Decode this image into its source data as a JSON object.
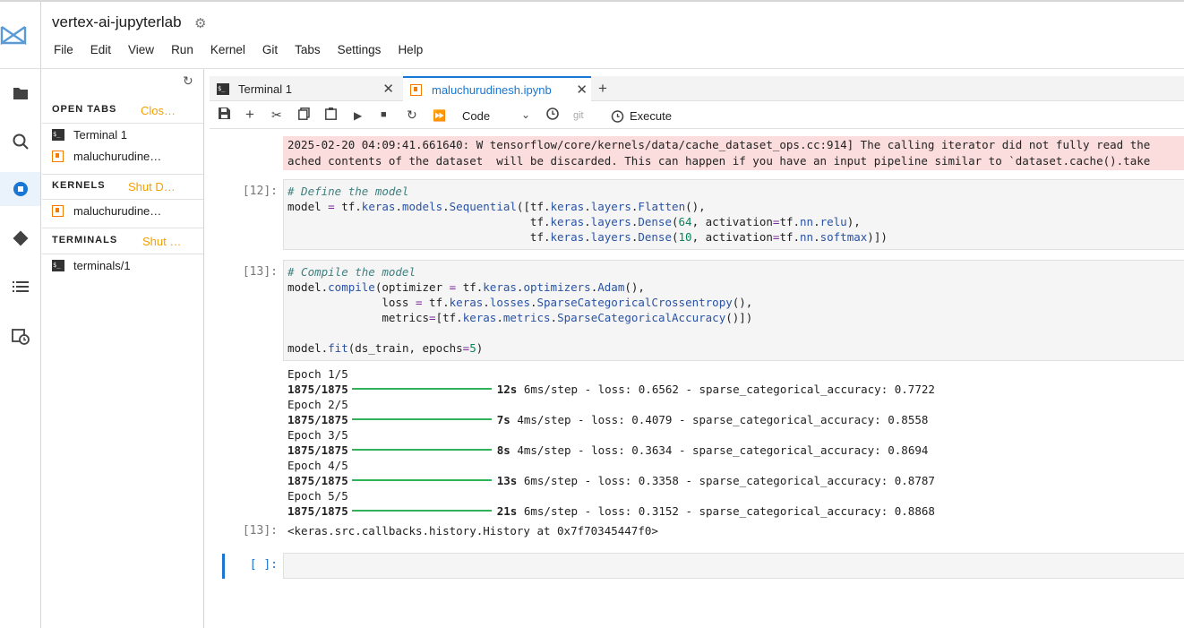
{
  "app": {
    "title": "vertex-ai-jupyterlab"
  },
  "menubar": [
    "File",
    "Edit",
    "View",
    "Run",
    "Kernel",
    "Git",
    "Tabs",
    "Settings",
    "Help"
  ],
  "sidebar": {
    "open_tabs_header": "OPEN TABS",
    "open_tabs_action": "Clos…",
    "open_tabs": [
      "Terminal 1",
      "maluchurudine…"
    ],
    "kernels_header": "KERNELS",
    "kernels_action": "Shut D…",
    "kernels": [
      "maluchurudine…"
    ],
    "terminals_header": "TERMINALS",
    "terminals_action": "Shut …",
    "terminals": [
      "terminals/1"
    ]
  },
  "tabs": [
    {
      "label": "Terminal 1",
      "icon": "terminal-icon"
    },
    {
      "label": "maluchurudinesh.ipynb",
      "icon": "notebook-icon",
      "active": true
    }
  ],
  "toolbar": {
    "cell_type": "Code",
    "git_label": "git",
    "execute_label": "Execute"
  },
  "cells": {
    "warning_line1": "2025-02-20 04:09:41.661640: W tensorflow/core/kernels/data/cache_dataset_ops.cc:914] The calling iterator did not fully read the",
    "warning_line2": "ached contents of the dataset  will be discarded. This can happen if you have an input pipeline similar to `dataset.cache().take",
    "cell12_prompt": "[12]:",
    "cell13_prompt": "[13]:",
    "cell13_out_prompt": "[13]:",
    "empty_prompt": "[ ]:",
    "history_output": "<keras.src.callbacks.history.History at 0x7f70345447f0>",
    "epochs": [
      {
        "label": "Epoch 1/5",
        "steps": "1875/1875",
        "time": "12s",
        "rest": "6ms/step - loss: 0.6562 - sparse_categorical_accuracy: 0.7722"
      },
      {
        "label": "Epoch 2/5",
        "steps": "1875/1875",
        "time": "7s",
        "rest": "4ms/step - loss: 0.4079 - sparse_categorical_accuracy: 0.8558"
      },
      {
        "label": "Epoch 3/5",
        "steps": "1875/1875",
        "time": "8s",
        "rest": "4ms/step - loss: 0.3634 - sparse_categorical_accuracy: 0.8694"
      },
      {
        "label": "Epoch 4/5",
        "steps": "1875/1875",
        "time": "13s",
        "rest": "6ms/step - loss: 0.3358 - sparse_categorical_accuracy: 0.8787"
      },
      {
        "label": "Epoch 5/5",
        "steps": "1875/1875",
        "time": "21s",
        "rest": "6ms/step - loss: 0.3152 - sparse_categorical_accuracy: 0.8868"
      }
    ]
  },
  "colors": {
    "accent": "#1976d2",
    "warning": "#f2a100",
    "error_bg": "#fbdddd",
    "progress": "#2fb35a"
  }
}
